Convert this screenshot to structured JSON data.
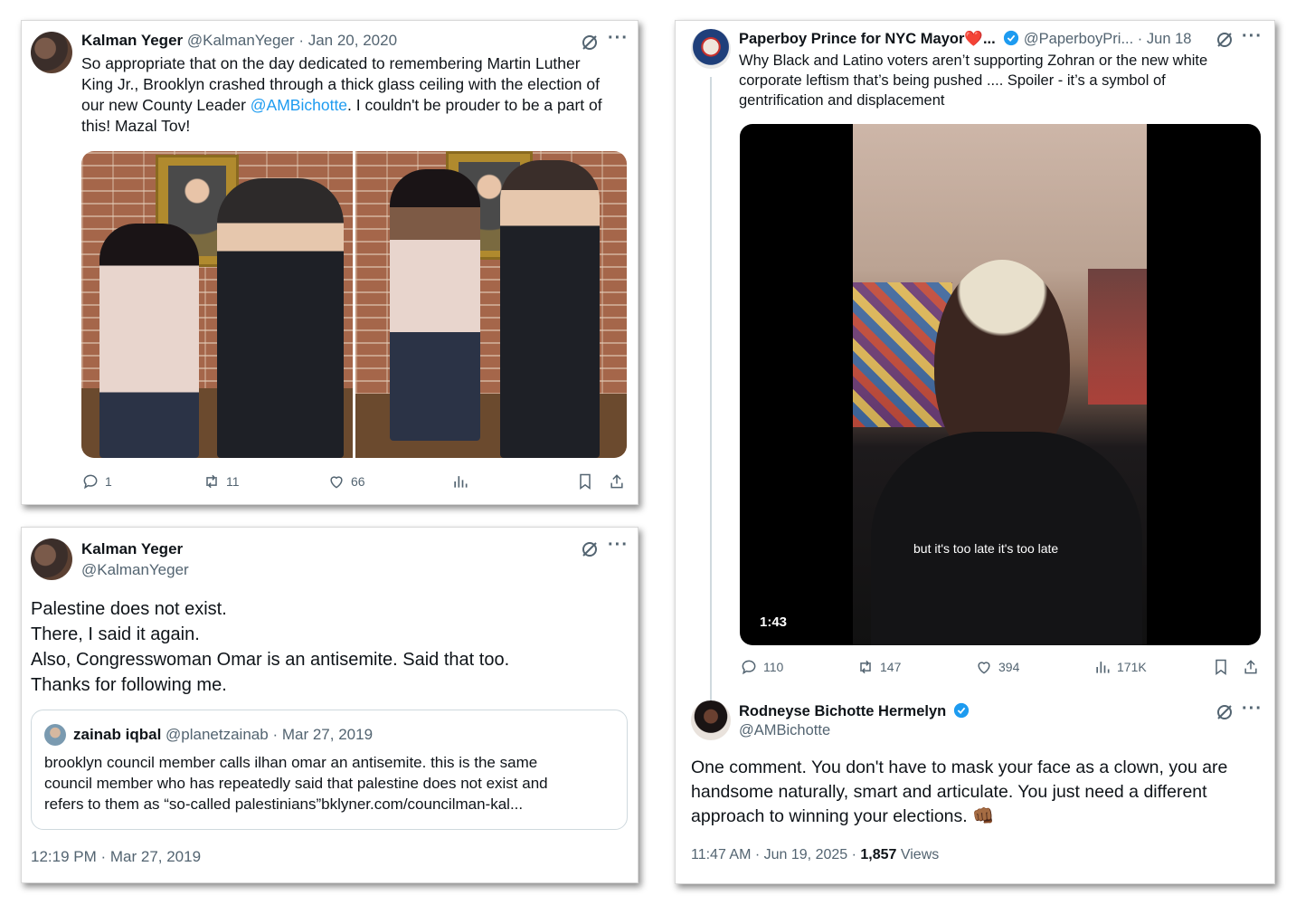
{
  "tweet1": {
    "name": "Kalman Yeger",
    "handle": "@KalmanYeger",
    "dot": "·",
    "date": "Jan 20, 2020",
    "text_a": "So appropriate that on the day dedicated to remembering Martin Luther",
    "text_b": "King Jr., Brooklyn crashed through a thick glass ceiling with the election of",
    "text_c1": "our new County Leader ",
    "mention": "@AMBichotte",
    "text_c2": ".  I couldn't be prouder to be a part of",
    "text_d": "this!  Mazal Tov!",
    "replies": "1",
    "reposts": "11",
    "likes": "66"
  },
  "tweet2": {
    "name": "Kalman Yeger",
    "handle": "@KalmanYeger",
    "line1": "Palestine does not exist.",
    "line2": "There, I said it again.",
    "line3": "Also, Congresswoman Omar is an antisemite.  Said that too.",
    "line4": "Thanks for following me.",
    "quote": {
      "name": "zainab iqbal",
      "handle": "@planetzainab",
      "dot": "·",
      "date": "Mar 27, 2019",
      "line1": "brooklyn council member calls ilhan omar an antisemite. this is the same",
      "line2": "council member who has repeatedly said that palestine does not exist and",
      "line3": "refers to them as “so-called palestinians”bklyner.com/councilman-kal..."
    },
    "timestamp": "12:19 PM · Mar 27, 2019"
  },
  "tweet3": {
    "name": "Paperboy Prince for NYC Mayor❤️...",
    "handle": "@PaperboyPri...",
    "dot": "·",
    "date": "Jun 18",
    "line1": "Why Black and Latino voters aren’t supporting Zohran or the new white",
    "line2": "corporate leftism that’s being pushed .... Spoiler - it’s a symbol of",
    "line3": "gentrification and displacement",
    "video_caption": "but it's too late it's too late",
    "video_duration": "1:43",
    "replies": "110",
    "reposts": "147",
    "likes": "394",
    "views": "171K"
  },
  "tweet4": {
    "name": "Rodneyse Bichotte Hermelyn",
    "handle": "@AMBichotte",
    "line1": "One comment. You don't have to mask your face as a clown, you are",
    "line2": "handsome naturally, smart and articulate. You just need a different",
    "line3": "approach to winning your elections. 👊🏾",
    "time": "11:47 AM · Jun 19, 2025 · ",
    "views_count": "1,857",
    "views_label": " Views"
  },
  "colors": {
    "link": "#1d9bf0",
    "muted": "#536471",
    "verified": "#1d9bf0"
  }
}
